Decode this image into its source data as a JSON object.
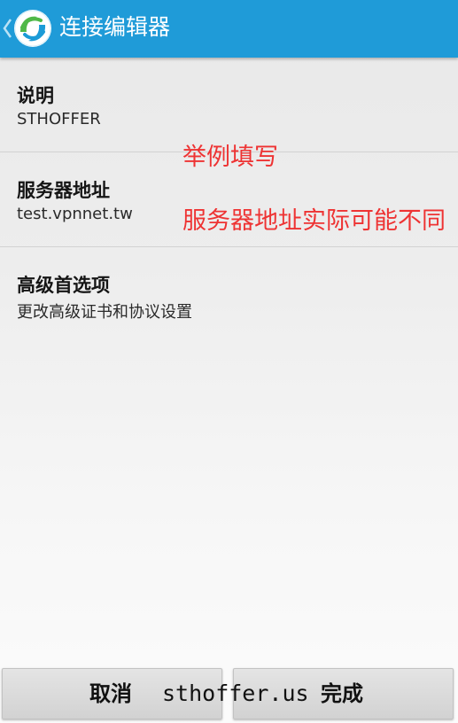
{
  "header": {
    "title": "连接编辑器",
    "back_icon": "chevron-left-icon",
    "logo_icon": "anyconnect-logo-icon",
    "background_color": "#1f9bd8"
  },
  "settings": {
    "description": {
      "title": "说明",
      "value": "STHOFFER"
    },
    "server_address": {
      "title": "服务器地址",
      "value": "test.vpnnet.tw"
    },
    "advanced": {
      "title": "高级首选项",
      "value": "更改高级证书和协议设置"
    }
  },
  "annotations": {
    "example_note": "举例填写",
    "server_note": "服务器地址实际可能不同",
    "color": "#ee3333"
  },
  "buttons": {
    "cancel_label": "取消",
    "done_label": "完成"
  },
  "watermark": "sthoffer.us"
}
